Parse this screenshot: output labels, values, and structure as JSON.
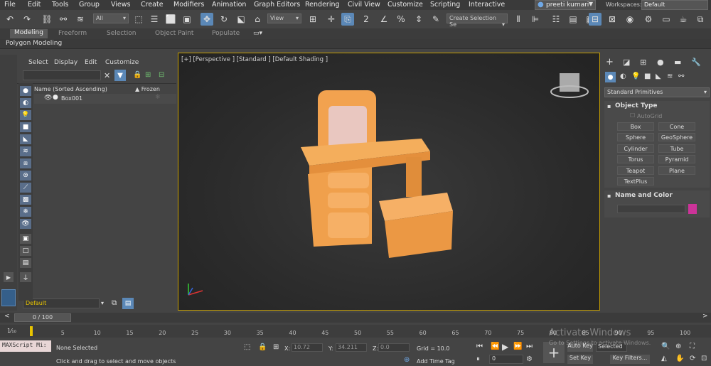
{
  "menus": [
    "File",
    "Edit",
    "Tools",
    "Group",
    "Views",
    "Create",
    "Modifiers",
    "Animation",
    "Graph Editors",
    "Rendering",
    "Civil View",
    "Customize",
    "Scripting",
    "Interactive"
  ],
  "user": "preeti kumari",
  "workspaces_label": "Workspaces:",
  "workspace_value": "Default",
  "toolbar": {
    "filter_value": "All",
    "view_value": "View",
    "selection_set_value": "Create Selection Se"
  },
  "ribbon_tabs": [
    "Modeling",
    "Freeform",
    "Selection",
    "Object Paint",
    "Populate"
  ],
  "poly_label": "Polygon Modeling",
  "scene_explorer": {
    "tabs": [
      "Select",
      "Display",
      "Edit",
      "Customize"
    ],
    "col_name": "Name (Sorted Ascending)",
    "col_frozen": "▲ Frozen",
    "rows": [
      "Box001"
    ],
    "layer_value": "Default"
  },
  "viewport": {
    "label": "[+] [Perspective ] [Standard ] [Default Shading ]"
  },
  "command_panel": {
    "category_value": "Standard Primitives",
    "object_type_title": "Object Type",
    "autogrid_label": "AutoGrid",
    "buttons": [
      "Box",
      "Cone",
      "Sphere",
      "GeoSphere",
      "Cylinder",
      "Tube",
      "Torus",
      "Pyramid",
      "Teapot",
      "Plane",
      "TextPlus"
    ],
    "name_color_title": "Name and Color",
    "object_color": "#cc3399"
  },
  "timeline": {
    "frame_display": "0 / 100",
    "ticks": [
      "0",
      "5",
      "10",
      "15",
      "20",
      "25",
      "30",
      "35",
      "40",
      "45",
      "50",
      "55",
      "60",
      "65",
      "70",
      "75",
      "80",
      "85",
      "90",
      "95",
      "100"
    ],
    "view_toggle": "1⁄₁₀"
  },
  "status": {
    "maxscript": "MAXScript Mi:",
    "none_selected": "None Selected",
    "hint": "Click and drag to select and move objects",
    "x_label": "X:",
    "x_value": "10.72",
    "y_label": "Y:",
    "y_value": "34.211",
    "z_label": "Z:",
    "z_value": "0.0",
    "grid": "Grid = 10.0",
    "add_time_tag": "Add Time Tag",
    "auto_key": "Auto Key",
    "selected": "Selected",
    "set_key": "Set Key",
    "key_filters": "Key Filters...",
    "current_frame": "0",
    "watermark1": "Activate Windows",
    "watermark2": "Go to Settings to activate Windows."
  },
  "colors": {
    "accent": "#5b88b7",
    "viewport_border": "#c8a000",
    "furniture": "#f2a24f"
  }
}
